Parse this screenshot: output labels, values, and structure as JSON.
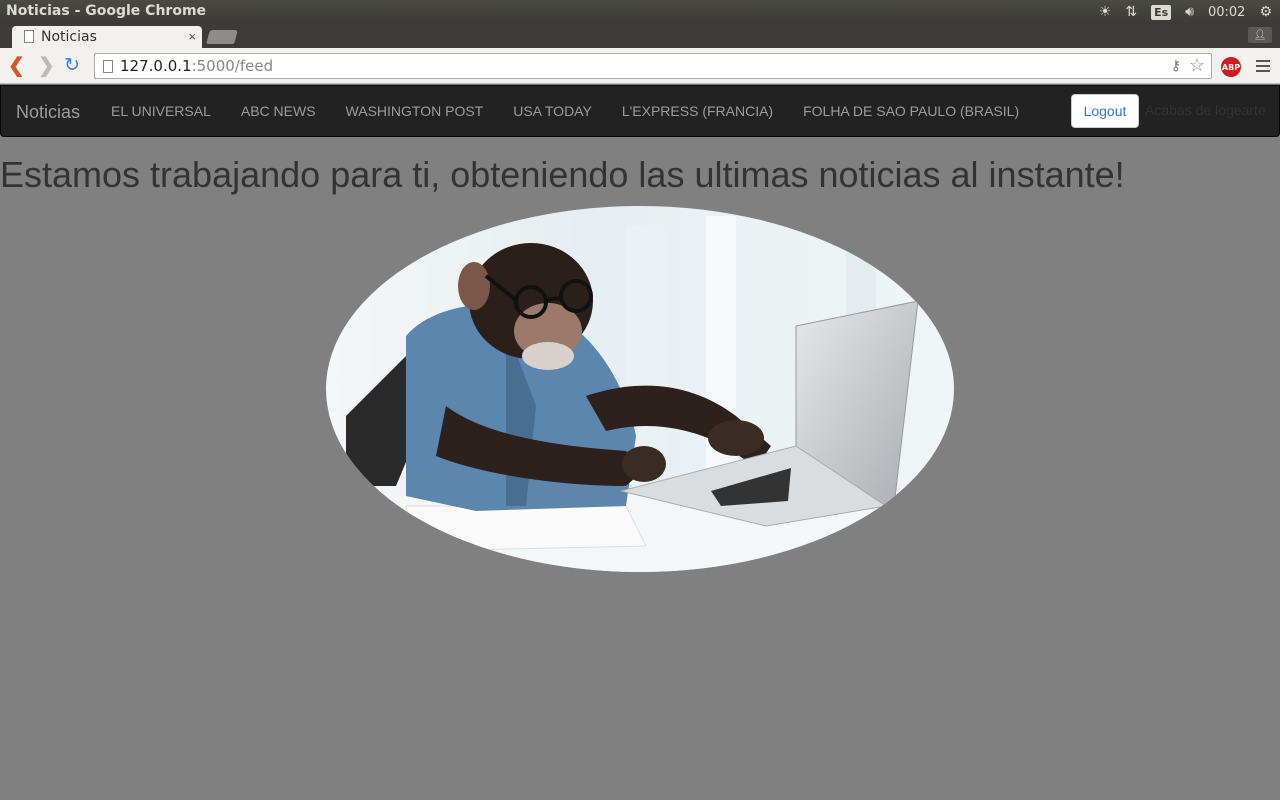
{
  "os_bar": {
    "window_title": "Noticias - Google Chrome",
    "keyboard_layout": "Es",
    "clock": "00:02"
  },
  "browser": {
    "tab_title": "Noticias",
    "tab_close": "×",
    "url_host": "127.0.0.1",
    "url_rest": ":5000/feed",
    "extension_label": "ABP"
  },
  "navbar": {
    "brand": "Noticias",
    "links": [
      "EL UNIVERSAL",
      "ABC NEWS",
      "WASHINGTON POST",
      "USA TODAY",
      "L'EXPRESS (FRANCIA)",
      "FOLHA DE SAO PAULO (BRASIL)"
    ],
    "logout_label": "Logout",
    "flash_message": "Acabas de logearte"
  },
  "main": {
    "headline": "Estamos trabajando para ti, obteniendo las ultimas noticias al instante!",
    "hero_image": "chimpanzee-typing-laptop-image"
  },
  "colors": {
    "page_background": "#808080",
    "navbar_background": "#222222",
    "link_color": "#9d9d9d",
    "logout_text": "#337ab7",
    "abp_red": "#cf1c1c"
  }
}
